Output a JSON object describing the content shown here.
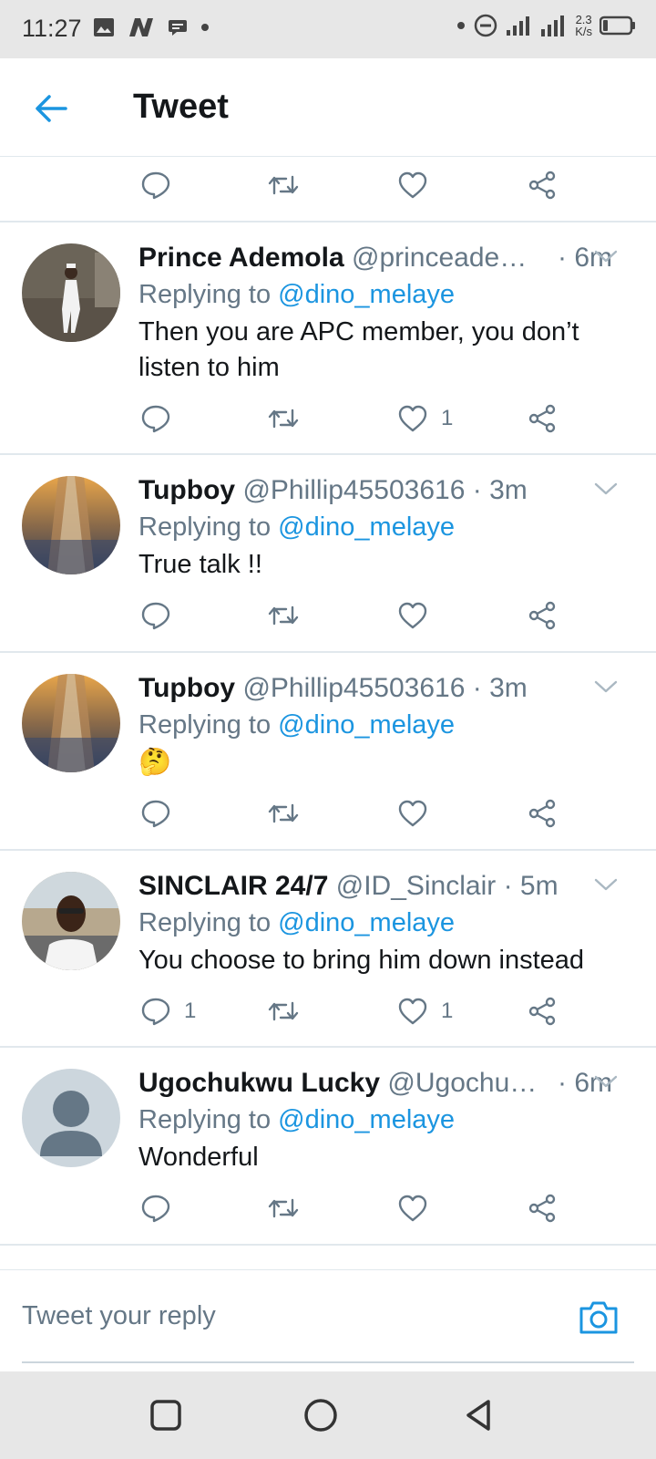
{
  "status_bar": {
    "time": "11:27",
    "net_speed_value": "2.3",
    "net_speed_unit": "K/s",
    "left_icons": [
      "image-icon",
      "n-app-icon",
      "message-icon",
      "dot-icon"
    ],
    "right_icons": [
      "dot-icon",
      "dnd-icon",
      "signal-icon",
      "signal-4g-icon",
      "battery-icon"
    ]
  },
  "app_bar": {
    "title": "Tweet"
  },
  "colors": {
    "accent": "#1b95e0",
    "secondary_text": "#657786",
    "primary_text": "#14171a",
    "divider": "#e1e8ed"
  },
  "tweets": [
    {
      "name": "Prince Ademola",
      "handle": "@princeade1…",
      "time": "· 6m",
      "replying_prefix": "Replying to",
      "replying_to": "@dino_melaye",
      "text": "Then you are APC member, you don’t listen to him",
      "reply_count": "",
      "like_count": "1"
    },
    {
      "name": "Tupboy",
      "handle": "@Phillip45503616",
      "time": "· 3m",
      "replying_prefix": "Replying to",
      "replying_to": "@dino_melaye",
      "text": "True talk !!",
      "reply_count": "",
      "like_count": ""
    },
    {
      "name": "Tupboy",
      "handle": "@Phillip45503616",
      "time": "· 3m",
      "replying_prefix": "Replying to",
      "replying_to": "@dino_melaye",
      "text": "🤔",
      "reply_count": "",
      "like_count": ""
    },
    {
      "name": "SINCLAIR 24/7",
      "handle": "@ID_Sinclair",
      "time": "· 5m",
      "replying_prefix": "Replying to",
      "replying_to": "@dino_melaye",
      "text": "You choose to bring him down instead",
      "reply_count": "1",
      "like_count": "1"
    },
    {
      "name": "Ugochukwu Lucky",
      "handle": "@Ugochuk…",
      "time": "· 6m",
      "replying_prefix": "Replying to",
      "replying_to": "@dino_melaye",
      "text": "Wonderful",
      "reply_count": "",
      "like_count": ""
    }
  ],
  "composer": {
    "placeholder": "Tweet your reply"
  },
  "nav_bar": {
    "buttons": [
      "recents-square-icon",
      "home-circle-icon",
      "back-triangle-icon"
    ]
  }
}
